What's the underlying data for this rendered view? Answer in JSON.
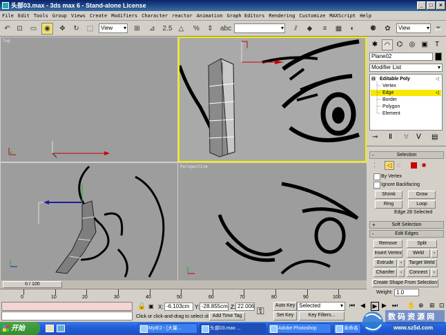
{
  "window": {
    "title": "头部03.max - 3ds max 6 - Stand-alone License"
  },
  "menu": [
    "File",
    "Edit",
    "Tools",
    "Group",
    "Views",
    "Create",
    "Modifiers",
    "Character",
    "reactor",
    "Animation",
    "Graph Editors",
    "Rendering",
    "Customize",
    "MAXScript",
    "Help"
  ],
  "toolbar": {
    "view_select": "View",
    "selection_set": "",
    "view_select_right": "View"
  },
  "viewports": {
    "top_label": "Top",
    "left_label": "",
    "perspective_label": "Perspective"
  },
  "cmd": {
    "object_name": "Plane02",
    "object_color": "#000000",
    "modifier_list": "Modifier List",
    "stack_root": "Editable Poly",
    "stack_items": [
      "Vertex",
      "Edge",
      "Border",
      "Polygon",
      "Element"
    ],
    "selected_subobject": "Edge",
    "selection_title": "Selection",
    "by_vertex": "By Vertex",
    "ignore_backfacing": "Ignore Backfacing",
    "shrink": "Shrink",
    "grow": "Grow",
    "ring": "Ring",
    "loop": "Loop",
    "selection_status": "Edge 28 Selected",
    "soft_selection_title": "Soft Selection",
    "edit_edges_title": "Edit Edges",
    "remove": "Remove",
    "split": "Split",
    "insert_vertex": "Insert Vertex",
    "weld": "Weld",
    "extrude": "Extrude",
    "target_weld": "Target Weld",
    "chamfer": "Chamfer",
    "connect": "Connect",
    "create_shape": "Create Shape From Selection",
    "weight_label": "Weight:",
    "weight_value": "1.0"
  },
  "timeline": {
    "slider_label": "0 / 100",
    "ticks": [
      "0",
      "10",
      "20",
      "30",
      "40",
      "50",
      "60",
      "70",
      "80",
      "90",
      "100"
    ]
  },
  "status": {
    "x_label": "X:",
    "x_value": "-6.103cm",
    "y_label": "Y:",
    "y_value": "-28.855cm",
    "z_label": "Z:",
    "z_value": "22.006cm",
    "prompt": "Click or click-and-drag to select ob",
    "add_time_tag": "Add Time Tag",
    "auto_key": "Auto Key",
    "set_key": "Set Key",
    "selected_dropdown": "Selected",
    "key_filters": "Key Filters..."
  },
  "taskbar": {
    "start": "开始",
    "tasks": [
      "MyIE2 - [大量...",
      "头部03.max ...",
      "Adobe Photoshop",
      "未命名 - ..."
    ],
    "watermark_text": "数 码 资 源 网",
    "watermark_url": "www.sz5d.com"
  }
}
